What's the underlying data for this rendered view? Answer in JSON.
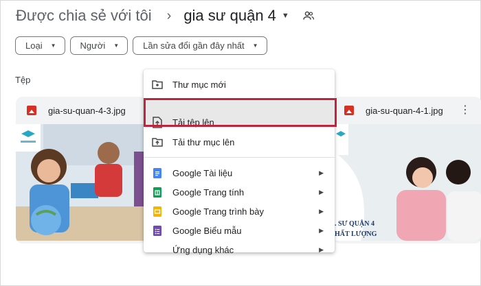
{
  "breadcrumb": {
    "parent": "Được chia sẻ với tôi",
    "separator": "›",
    "current": "gia sư quận 4"
  },
  "filters": [
    "Loại",
    "Người",
    "Lần sửa đổi gần đây nhất"
  ],
  "section_label": "Tệp",
  "files": [
    {
      "name": "gia-su-quan-4-3.jpg"
    },
    {
      "name": "gia-su-quan-4-1.jpg",
      "caption_line1": ". SƯ QUẬN 4",
      "caption_line2": "HẤT LƯỢNG"
    }
  ],
  "menu": {
    "items": [
      {
        "label": "Thư mục mới",
        "icon": "new-folder-icon"
      },
      {
        "label": "Tải tệp lên",
        "icon": "file-upload-icon"
      },
      {
        "label": "Tải thư mục lên",
        "icon": "folder-upload-icon"
      },
      {
        "label": "Google Tài liệu",
        "icon": "google-docs-icon"
      },
      {
        "label": "Google Trang tính",
        "icon": "google-sheets-icon"
      },
      {
        "label": "Google Trang trình bày",
        "icon": "google-slides-icon"
      },
      {
        "label": "Google Biểu mẫu",
        "icon": "google-forms-icon"
      },
      {
        "label": "Ứng dụng khác",
        "icon": "more-apps"
      }
    ]
  },
  "colors": {
    "highlight_border": "#c0233c",
    "docs": "#4285f4",
    "sheets": "#0f9d58",
    "slides": "#f4b400",
    "forms": "#7248b9",
    "image_icon": "#d93025"
  }
}
